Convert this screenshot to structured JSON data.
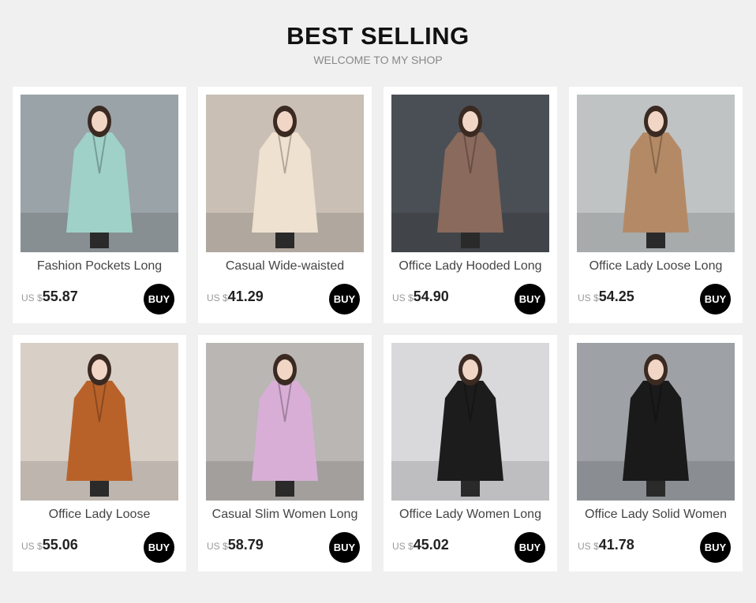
{
  "header": {
    "title": "BEST SELLING",
    "subtitle": "WELCOME TO MY SHOP"
  },
  "products": [
    {
      "name": "Fashion Pockets Long",
      "currency": "US $",
      "price": "55.87",
      "buy_label": "BUY",
      "coat_color": "#9fd1c8",
      "bg_color": "#9aa3a8"
    },
    {
      "name": "Casual Wide-waisted",
      "currency": "US $",
      "price": "41.29",
      "buy_label": "BUY",
      "coat_color": "#efe1cf",
      "bg_color": "#c9bfb4"
    },
    {
      "name": "Office Lady Hooded Long",
      "currency": "US $",
      "price": "54.90",
      "buy_label": "BUY",
      "coat_color": "#8a6a5c",
      "bg_color": "#4a4f55"
    },
    {
      "name": "Office Lady Loose Long",
      "currency": "US $",
      "price": "54.25",
      "buy_label": "BUY",
      "coat_color": "#b48a66",
      "bg_color": "#bfc3c4"
    },
    {
      "name": "Office Lady Loose",
      "currency": "US $",
      "price": "55.06",
      "buy_label": "BUY",
      "coat_color": "#b8622a",
      "bg_color": "#d8cfc6"
    },
    {
      "name": "Casual Slim Women Long",
      "currency": "US $",
      "price": "58.79",
      "buy_label": "BUY",
      "coat_color": "#d8aed6",
      "bg_color": "#b9b6b3"
    },
    {
      "name": "Office Lady Women Long",
      "currency": "US $",
      "price": "45.02",
      "buy_label": "BUY",
      "coat_color": "#1c1c1c",
      "bg_color": "#d9d9db"
    },
    {
      "name": "Office Lady Solid Women",
      "currency": "US $",
      "price": "41.78",
      "buy_label": "BUY",
      "coat_color": "#1a1a1a",
      "bg_color": "#9ea2a7"
    }
  ]
}
